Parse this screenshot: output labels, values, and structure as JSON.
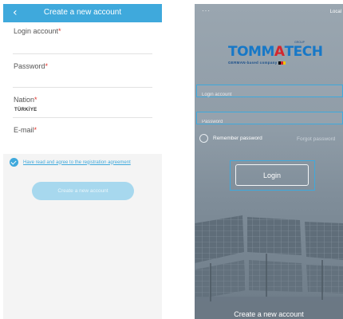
{
  "register": {
    "back_icon": "chevron-left-icon",
    "title": "Create a new account",
    "fields": [
      {
        "label": "Login account",
        "required": "*"
      },
      {
        "label": "Password",
        "required": "*"
      },
      {
        "label": "Nation",
        "required": "*",
        "value": "TÜRKİYE"
      },
      {
        "label": "E-mail",
        "required": "*"
      }
    ],
    "agreement_text": "Have read and agree to the registration agreement",
    "agreement_checked": true,
    "submit_label": "Create a new account",
    "accent_color": "#3fa9dc"
  },
  "login": {
    "menu_icon": "more-dots-icon",
    "menu_glyph": "···",
    "language_label": "Local",
    "logo": {
      "brand": "TOMMATECH",
      "tagline": "GERMAN-based company",
      "group": "GROUP"
    },
    "account_placeholder": "Login account",
    "password_placeholder": "Password",
    "remember_label": "Remember password",
    "forgot_label": "Forgot password",
    "login_label": "Login",
    "create_label": "Create a new account",
    "highlight_color": "#3fa9dc"
  }
}
